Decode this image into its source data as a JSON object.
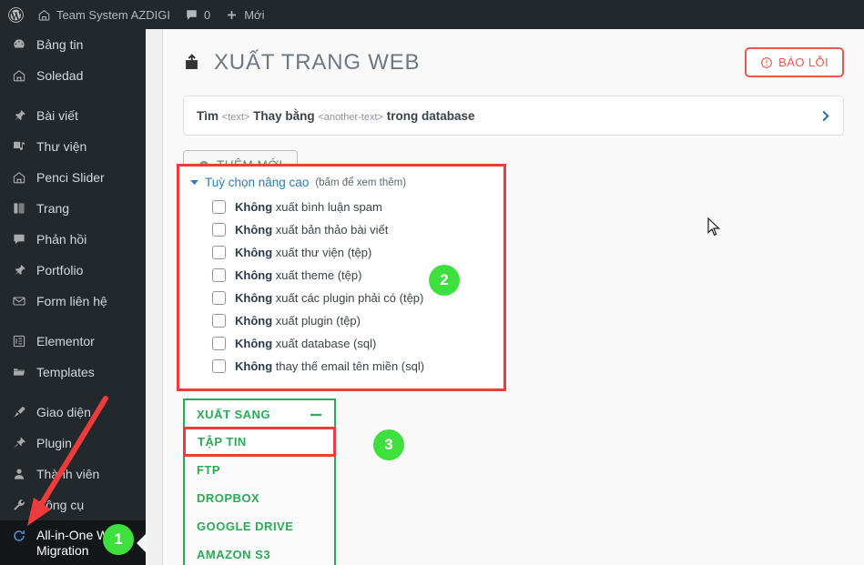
{
  "adminbar": {
    "wp_logo": "wordpress-logo-icon",
    "home_icon": "home-icon",
    "site_name": "Team System AZDIGI",
    "comment_icon": "comment-icon",
    "comment_count": "0",
    "plus_icon": "plus-icon",
    "new_label": "Mới"
  },
  "sidebar": {
    "items": [
      {
        "label": "Bảng tin",
        "icon": "dashboard-icon",
        "active": false
      },
      {
        "label": "Soledad",
        "icon": "home-icon",
        "active": false
      },
      {
        "label": "Bài viết",
        "icon": "pin-icon",
        "active": false
      },
      {
        "label": "Thư viện",
        "icon": "media-icon",
        "active": false
      },
      {
        "label": "Penci Slider",
        "icon": "home-icon",
        "active": false
      },
      {
        "label": "Trang",
        "icon": "page-icon",
        "active": false
      },
      {
        "label": "Phản hồi",
        "icon": "comment-icon",
        "active": false
      },
      {
        "label": "Portfolio",
        "icon": "pin-icon",
        "active": false
      },
      {
        "label": "Form liên hệ",
        "icon": "mail-icon",
        "active": false
      },
      {
        "label": "Elementor",
        "icon": "elementor-icon",
        "active": false
      },
      {
        "label": "Templates",
        "icon": "folder-icon",
        "active": false
      },
      {
        "label": "Giao diện",
        "icon": "brush-icon",
        "active": false
      },
      {
        "label": "Plugin",
        "icon": "plug-icon",
        "active": false
      },
      {
        "label": "Thành viên",
        "icon": "user-icon",
        "active": false
      },
      {
        "label": "Công cụ",
        "icon": "wrench-icon",
        "active": false
      },
      {
        "label": "All-in-One WP Migration",
        "icon": "migration-icon",
        "active": true
      }
    ]
  },
  "header": {
    "title": "XUẤT TRANG WEB",
    "title_icon": "export-icon",
    "report_button": {
      "label": "BÁO LỖI",
      "icon": "exclamation-circle-icon",
      "color": "#e8584c"
    }
  },
  "find_replace": {
    "find_label": "Tìm",
    "find_tag": "<text>",
    "replace_label": "Thay bằng",
    "replace_tag": "<another-text>",
    "suffix": "trong database",
    "chevron_icon": "chevron-right-icon"
  },
  "add_button": {
    "label": "THÊM MỚI",
    "icon": "plus-circle-icon"
  },
  "advanced": {
    "title": "Tuỳ chọn nâng cao",
    "hint": "(bấm để xem thêm)",
    "caret_icon": "caret-down-icon",
    "highlight_color": "#ef3b3b",
    "options": [
      {
        "strong": "Không",
        "rest": " xuất bình luận spam",
        "checked": false
      },
      {
        "strong": "Không",
        "rest": " xuất bản thảo bài viết",
        "checked": false
      },
      {
        "strong": "Không",
        "rest": " xuất thư viện (tệp)",
        "checked": false
      },
      {
        "strong": "Không",
        "rest": " xuất theme (tệp)",
        "checked": false
      },
      {
        "strong": "Không",
        "rest": " xuất các plugin phải có (tệp)",
        "checked": false
      },
      {
        "strong": "Không",
        "rest": " xuất plugin (tệp)",
        "checked": false
      },
      {
        "strong": "Không",
        "rest": " xuất database (sql)",
        "checked": false
      },
      {
        "strong": "Không",
        "rest": " thay thế email tên miền (sql)",
        "checked": false
      }
    ]
  },
  "export_to": {
    "header_label": "XUẤT SANG",
    "collapse_icon": "minus-icon",
    "accent_color": "#2aab55",
    "options": [
      {
        "label": "TẬP TIN",
        "selected": true
      },
      {
        "label": "FTP",
        "selected": false
      },
      {
        "label": "DROPBOX",
        "selected": false
      },
      {
        "label": "GOOGLE DRIVE",
        "selected": false
      },
      {
        "label": "AMAZON S3",
        "selected": false
      }
    ]
  },
  "callouts": {
    "badge_color": "#3ee03e",
    "arrow_color": "#ef3b3b",
    "steps": [
      {
        "number": "1"
      },
      {
        "number": "2"
      },
      {
        "number": "3"
      }
    ]
  },
  "cursor": {
    "icon": "mouse-pointer-icon"
  }
}
